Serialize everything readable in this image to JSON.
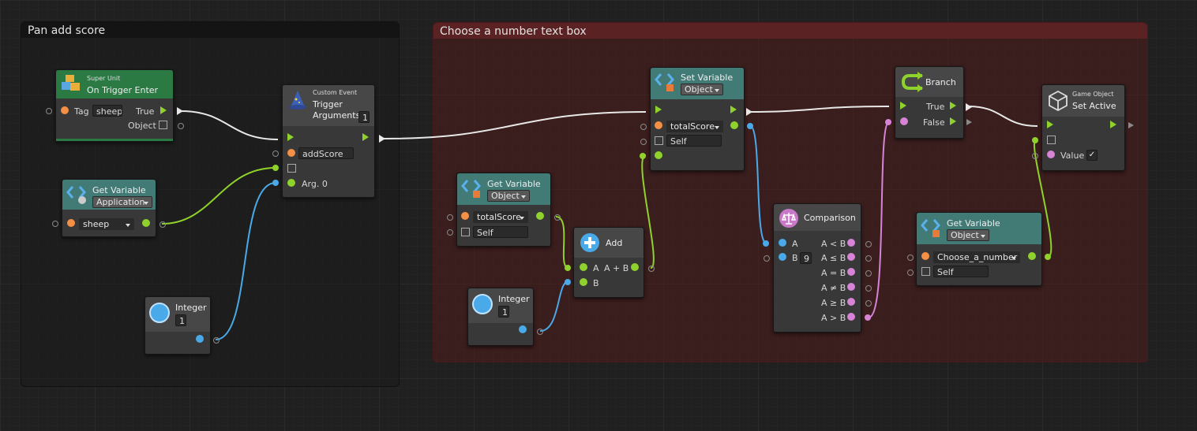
{
  "groups": {
    "left": {
      "title": "Pan add score"
    },
    "right": {
      "title": "Choose a number text box"
    }
  },
  "nodes": {
    "trigger_enter": {
      "kind": "Super Unit",
      "title": "On Trigger Enter",
      "tag_label": "Tag",
      "tag_value": "sheep",
      "true_label": "True",
      "object_label": "Object"
    },
    "get_var_app": {
      "title": "Get Variable",
      "scope": "Application",
      "name": "sheep"
    },
    "integer_left": {
      "title": "Integer",
      "value": "1"
    },
    "custom_event": {
      "kind": "Custom Event",
      "title_line1": "Trigger",
      "title_line2": "Arguments",
      "count": "1",
      "event_name": "addScore",
      "arg_label": "Arg. 0"
    },
    "get_var_obj": {
      "title": "Get Variable",
      "scope": "Object",
      "name": "totalScore",
      "target": "Self"
    },
    "integer_right": {
      "title": "Integer",
      "value": "1"
    },
    "add": {
      "title": "Add",
      "a_label": "A",
      "sum_label": "A + B",
      "b_label": "B"
    },
    "set_var": {
      "title": "Set Variable",
      "scope": "Object",
      "name": "totalScore",
      "target": "Self"
    },
    "comparison": {
      "title": "Comparison",
      "a_label": "A",
      "b_label": "B",
      "b_value": "9",
      "outputs": [
        "A < B",
        "A ≤ B",
        "A = B",
        "A ≠ B",
        "A ≥ B",
        "A > B"
      ]
    },
    "branch": {
      "title": "Branch",
      "true_label": "True",
      "false_label": "False"
    },
    "set_active": {
      "kind": "Game Object",
      "title": "Set Active",
      "value_label": "Value",
      "value_checked": "✓"
    },
    "get_var_choose": {
      "title": "Get Variable",
      "scope": "Object",
      "name": "Choose_a_number",
      "target": "Self"
    }
  },
  "colors": {
    "background": "#202020",
    "flow": "#8fd22b",
    "float": "#4aa9e8",
    "bool": "#d783d6",
    "object": "#f49045",
    "control_wire": "#e8e8e8"
  }
}
